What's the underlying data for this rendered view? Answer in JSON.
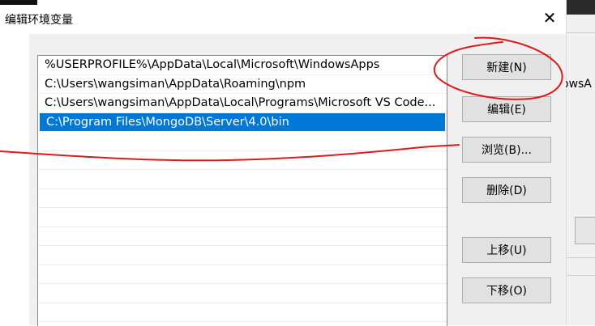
{
  "dialog": {
    "title": "编辑环境变量",
    "close_glyph": "✕"
  },
  "paths": [
    "%USERPROFILE%\\AppData\\Local\\Microsoft\\WindowsApps",
    "C:\\Users\\wangsiman\\AppData\\Roaming\\npm",
    "C:\\Users\\wangsiman\\AppData\\Local\\Programs\\Microsoft VS Code...",
    "C:\\Program Files\\MongoDB\\Server\\4.0\\bin"
  ],
  "selected_index": 3,
  "buttons": {
    "new": "新建(N)",
    "edit": "编辑(E)",
    "browse": "浏览(B)...",
    "delete": "删除(D)",
    "move_up": "上移(U)",
    "move_down": "下移(O)"
  },
  "background_window": {
    "text": "owsA"
  },
  "colors": {
    "selection": "#0078d7",
    "annotation": "#e0191b"
  }
}
